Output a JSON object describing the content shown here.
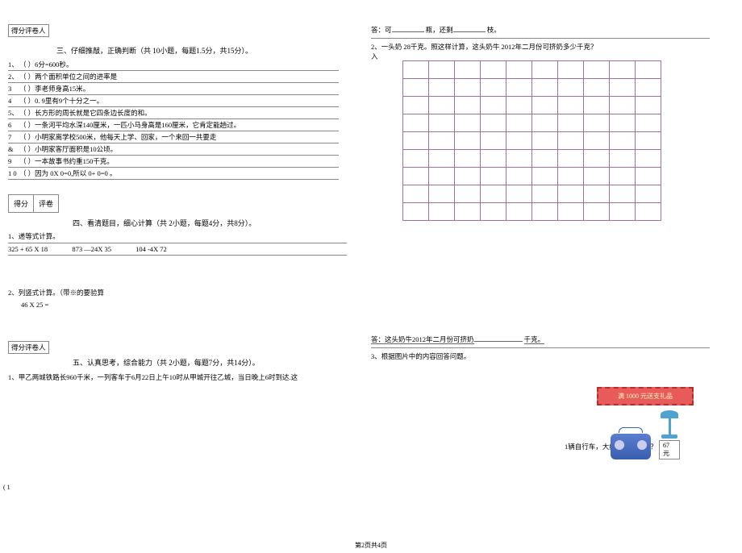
{
  "left": {
    "score_header": "得分评卷人",
    "sec3_title": "三、仔细推敲，正确判断（共     10小题，每题1.5分，共15分）。",
    "q": [
      {
        "no": "1、",
        "pr": "（        ）",
        "txt": "6分=600秒。"
      },
      {
        "no": "2、",
        "pr": "（        ）",
        "txt": "两个面积单位之间的进率是"
      },
      {
        "no": "3",
        "pr": "（        ）",
        "txt": "李老师身高15米。"
      },
      {
        "no": "4",
        "pr": "（        ）",
        "txt": "0. 9里有9个十分之一。"
      },
      {
        "no": "5、",
        "pr": "（        ）",
        "txt": "长方形的周长就是它四条边长度的和。"
      },
      {
        "no": "6",
        "pr": "（        ）",
        "txt": "一条河平均水深140厘米，一匹小马身高是160厘米，它肯定能趟过。"
      },
      {
        "no": "7",
        "pr": "（        ）",
        "txt": "小明家离学校500米，他每天上学、回家，一个来回一共要走"
      },
      {
        "no": "&",
        "pr": "（        ）",
        "txt": "小明家客厅面积是10公顷。"
      },
      {
        "no": "9",
        "pr": "（        ）",
        "txt": "一本故事书约重150千克。"
      },
      {
        "no": "1\n0",
        "pr": "（        ）",
        "txt": "因为 0X 0=0,所以  0+ 0=0 。"
      }
    ],
    "score_box2_a": "得分",
    "score_box2_b": "评卷",
    "sec4_title": "四、看清题目，细心计算（共     2小题，每题4分，共8分）。",
    "sub4_1": "1、递等式计算。",
    "expr1": "325 + 65 X 18",
    "expr2": "873       —24X 35",
    "expr3": "104      -4X 72",
    "sub4_2": "2、列竖式计算。（带※的要验算",
    "sub4_2b": "46 X 25 =",
    "score_header2": "得分评卷人",
    "sec5_title": "五、认真思考，综合能力（共  2小题，每题7分，共14分）。",
    "sec5_q1": "1、甲乙两城铁路长960千米，一列客车于6月22日上午10时从甲城开往乙城，当日晚上6时到达.这"
  },
  "right": {
    "ans1_pre": "答：可",
    "ans1_mid": "瓶，还剩",
    "ans1_suf": "枝。",
    "q2": "2、一头奶                                            28千克。照这样计算，这头奶牛     2012年二月份可挤奶多少千克？",
    "q2_ru": "入",
    "ans2_pre": "答：这头奶牛2012年二月份可挤奶",
    "ans2_suf": "千克。",
    "q3_title": "3、根据图片中的内容回答问题。",
    "promo_banner": "满 1000 元送支礼品",
    "price": "67 元",
    "q3_q": "1辆自行车，大约需要多少钱？"
  },
  "left_pg": "( 1",
  "footer": "第2页共4页"
}
